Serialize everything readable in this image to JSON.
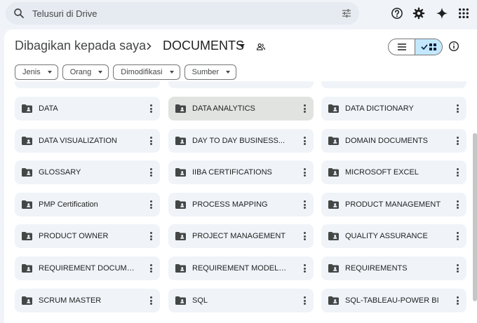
{
  "search": {
    "placeholder": "Telusuri di Drive"
  },
  "header": {
    "parent": "Dibagikan kepada saya",
    "current": "DOCUMENTS"
  },
  "filters": [
    {
      "label": "Jenis"
    },
    {
      "label": "Orang"
    },
    {
      "label": "Dimodifikasi"
    },
    {
      "label": "Sumber"
    }
  ],
  "folders": [
    {
      "name": "DATA"
    },
    {
      "name": "DATA ANALYTICS",
      "selected": true
    },
    {
      "name": "DATA DICTIONARY"
    },
    {
      "name": "DATA VISUALIZATION"
    },
    {
      "name": "DAY TO DAY BUSINESS..."
    },
    {
      "name": "DOMAIN DOCUMENTS"
    },
    {
      "name": "GLOSSARY"
    },
    {
      "name": "IIBA CERTIFICATIONS"
    },
    {
      "name": "MICROSOFT EXCEL"
    },
    {
      "name": "PMP Certification"
    },
    {
      "name": "PROCESS MAPPING"
    },
    {
      "name": "PRODUCT MANAGEMENT"
    },
    {
      "name": "PRODUCT OWNER"
    },
    {
      "name": "PROJECT MANAGEMENT"
    },
    {
      "name": "QUALITY ASSURANCE"
    },
    {
      "name": "REQUIREMENT DOCUMENTS"
    },
    {
      "name": "REQUIREMENT MODELLING"
    },
    {
      "name": "REQUIREMENTS"
    },
    {
      "name": "SCRUM MASTER"
    },
    {
      "name": "SQL"
    },
    {
      "name": "SQL-TABLEAU-POWER BI"
    }
  ],
  "icons": {
    "search": "search-icon",
    "tune": "tune-icon",
    "help": "help-icon",
    "settings": "gear-icon",
    "gemini": "sparkle-icon",
    "apps": "apps-grid-icon",
    "folder": "shared-folder-icon",
    "more": "more-vert-icon",
    "info": "info-icon"
  },
  "colors": {
    "page_bg": "#f0f4f9",
    "card_bg": "#f0f4f9",
    "selected_card_bg": "#e1e3e1",
    "active_view_toggle": "#c2e7ff"
  }
}
